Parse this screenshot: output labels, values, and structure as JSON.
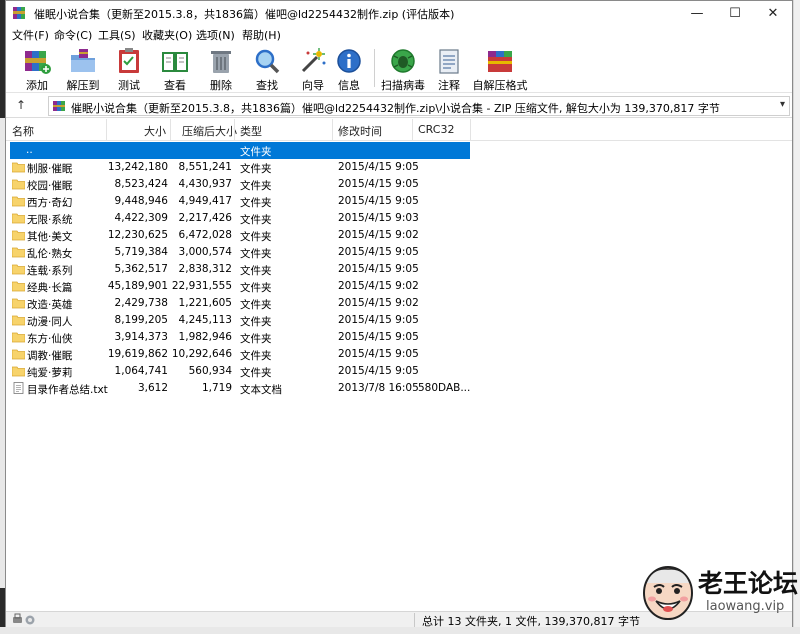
{
  "window": {
    "title": "催眠小说合集（更新至2015.3.8，共1836篇）催吧@ld2254432制作.zip (评估版本)",
    "minimize": "—",
    "maximize": "☐",
    "close": "✕"
  },
  "menu": [
    "文件(F)",
    "命令(C)",
    "工具(S)",
    "收藏夹(O)",
    "选项(N)",
    "帮助(H)"
  ],
  "toolbar": {
    "add": "添加",
    "extract": "解压到",
    "test": "测试",
    "view": "查看",
    "delete": "删除",
    "find": "查找",
    "wizard": "向导",
    "info": "信息",
    "virus_scan": "扫描病毒",
    "comment": "注释",
    "sfx": "自解压格式"
  },
  "address": {
    "up_label": "↑",
    "path": "催眠小说合集（更新至2015.3.8，共1836篇）催吧@ld2254432制作.zip\\小说合集 - ZIP 压缩文件, 解包大小为 139,370,817 字节"
  },
  "columns": [
    "名称",
    "大小",
    "压缩后大小",
    "类型",
    "修改时间",
    "CRC32"
  ],
  "rows": [
    {
      "name": "..",
      "size": "",
      "packed": "",
      "type": "文件夹",
      "modified": "",
      "crc": "",
      "icon": "parent",
      "selected": true
    },
    {
      "name": "制服·催眠",
      "size": "13,242,180",
      "packed": "8,551,241",
      "type": "文件夹",
      "modified": "2015/4/15 9:05",
      "crc": "",
      "icon": "folder"
    },
    {
      "name": "校园·催眠",
      "size": "8,523,424",
      "packed": "4,430,937",
      "type": "文件夹",
      "modified": "2015/4/15 9:05",
      "crc": "",
      "icon": "folder"
    },
    {
      "name": "西方·奇幻",
      "size": "9,448,946",
      "packed": "4,949,417",
      "type": "文件夹",
      "modified": "2015/4/15 9:05",
      "crc": "",
      "icon": "folder"
    },
    {
      "name": "无限·系统",
      "size": "4,422,309",
      "packed": "2,217,426",
      "type": "文件夹",
      "modified": "2015/4/15 9:03",
      "crc": "",
      "icon": "folder"
    },
    {
      "name": "其他·美文",
      "size": "12,230,625",
      "packed": "6,472,028",
      "type": "文件夹",
      "modified": "2015/4/15 9:02",
      "crc": "",
      "icon": "folder"
    },
    {
      "name": "乱伦·熟女",
      "size": "5,719,384",
      "packed": "3,000,574",
      "type": "文件夹",
      "modified": "2015/4/15 9:05",
      "crc": "",
      "icon": "folder"
    },
    {
      "name": "连载·系列",
      "size": "5,362,517",
      "packed": "2,838,312",
      "type": "文件夹",
      "modified": "2015/4/15 9:05",
      "crc": "",
      "icon": "folder"
    },
    {
      "name": "经典·长篇",
      "size": "45,189,901",
      "packed": "22,931,555",
      "type": "文件夹",
      "modified": "2015/4/15 9:02",
      "crc": "",
      "icon": "folder"
    },
    {
      "name": "改造·英雄",
      "size": "2,429,738",
      "packed": "1,221,605",
      "type": "文件夹",
      "modified": "2015/4/15 9:02",
      "crc": "",
      "icon": "folder"
    },
    {
      "name": "动漫·同人",
      "size": "8,199,205",
      "packed": "4,245,113",
      "type": "文件夹",
      "modified": "2015/4/15 9:05",
      "crc": "",
      "icon": "folder"
    },
    {
      "name": "东方·仙侠",
      "size": "3,914,373",
      "packed": "1,982,946",
      "type": "文件夹",
      "modified": "2015/4/15 9:05",
      "crc": "",
      "icon": "folder"
    },
    {
      "name": "调教·催眠",
      "size": "19,619,862",
      "packed": "10,292,646",
      "type": "文件夹",
      "modified": "2015/4/15 9:05",
      "crc": "",
      "icon": "folder"
    },
    {
      "name": "纯爱·萝莉",
      "size": "1,064,741",
      "packed": "560,934",
      "type": "文件夹",
      "modified": "2015/4/15 9:05",
      "crc": "",
      "icon": "folder"
    },
    {
      "name": "目录作者总结.txt",
      "size": "3,612",
      "packed": "1,719",
      "type": "文本文档",
      "modified": "2013/7/8 16:05",
      "crc": "580DAB...",
      "icon": "text"
    }
  ],
  "status": {
    "summary": "总计 13 文件夹, 1 文件, 139,370,817 字节"
  },
  "watermark": {
    "title": "老王论坛",
    "url": "laowang.vip"
  },
  "colors": {
    "selection": "#0078d7",
    "folder": "#f7d36b",
    "folder_edge": "#d9a832"
  }
}
